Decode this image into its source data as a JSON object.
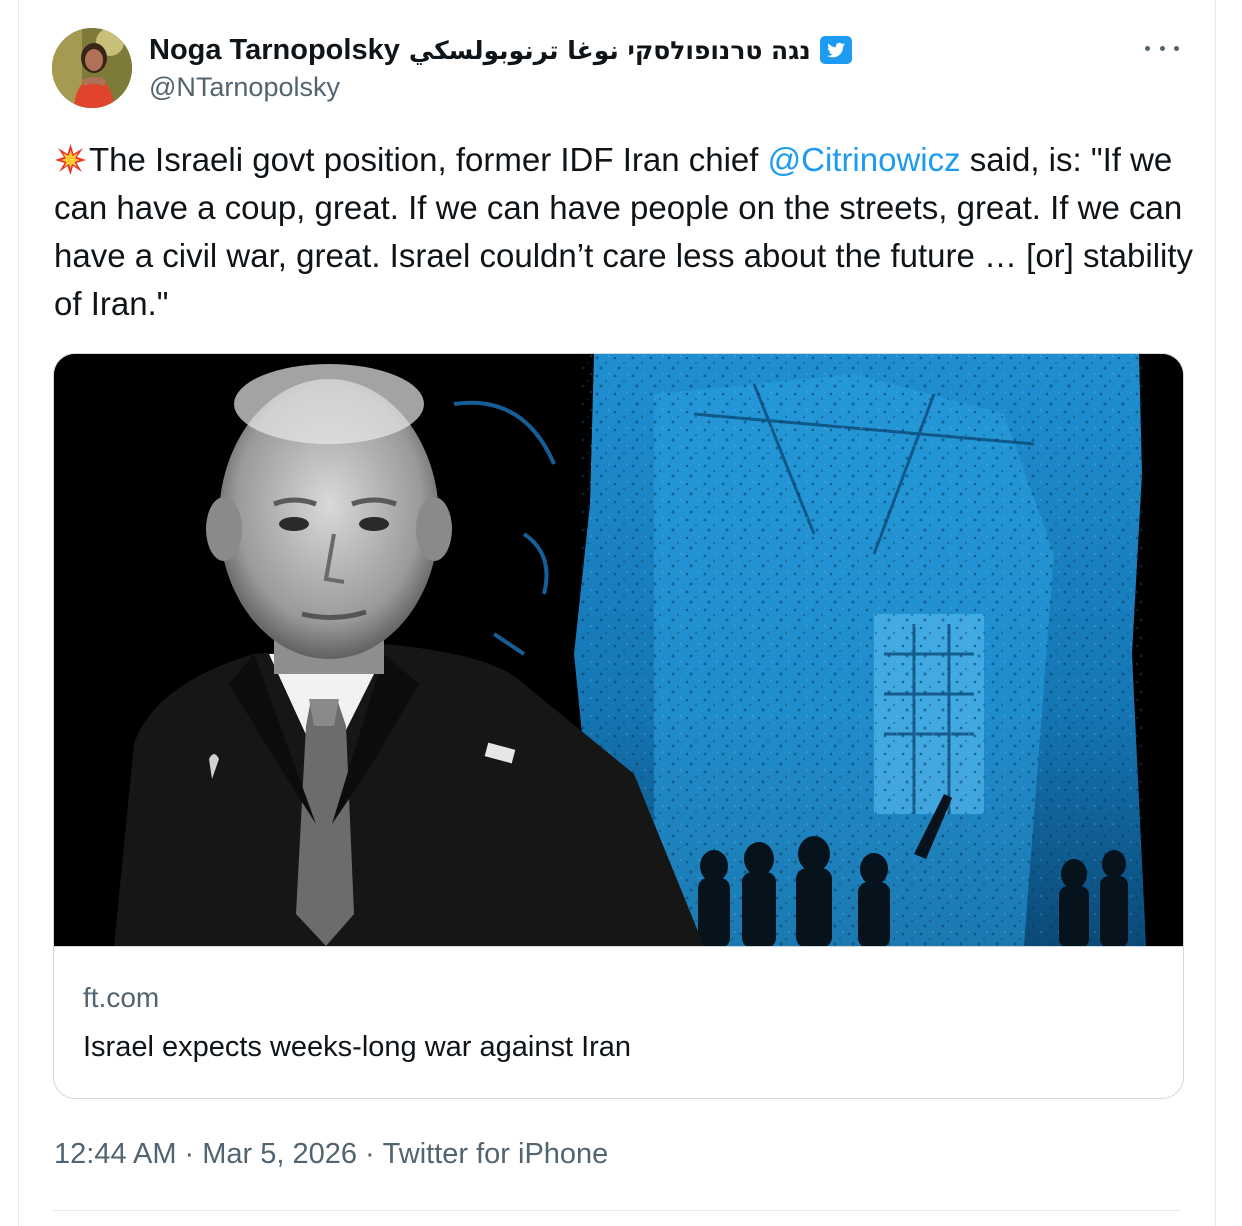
{
  "author": {
    "display_name": "Noga Tarnopolsky",
    "display_name_rtl": "נגה טרנופולסקי نوغا ترنوبولسكي",
    "handle": "@NTarnopolsky",
    "verified_icon": "verified-bird-icon",
    "avatar_icon": "avatar"
  },
  "tweet": {
    "emoji_icon": "collision-icon",
    "text_before_mention": "The Israeli govt position, former IDF Iran chief ",
    "mention": "@Citrinowicz",
    "text_after_mention": " said, is: \"If we can have a coup, great. If we can have people on the streets, great. If we can have a civil war, great. Israel couldn’t care less about the future … [or] stability of Iran.\""
  },
  "link_card": {
    "domain": "ft.com",
    "title": "Israel expects weeks-long war against Iran"
  },
  "meta": {
    "time": "12:44 AM",
    "separator": "·",
    "date": "Mar 5, 2026",
    "source": "Twitter for iPhone"
  },
  "colors": {
    "link": "#1d9bf0",
    "secondary_text": "#536471",
    "primary_text": "#0f1419",
    "border": "#cfd9de"
  }
}
